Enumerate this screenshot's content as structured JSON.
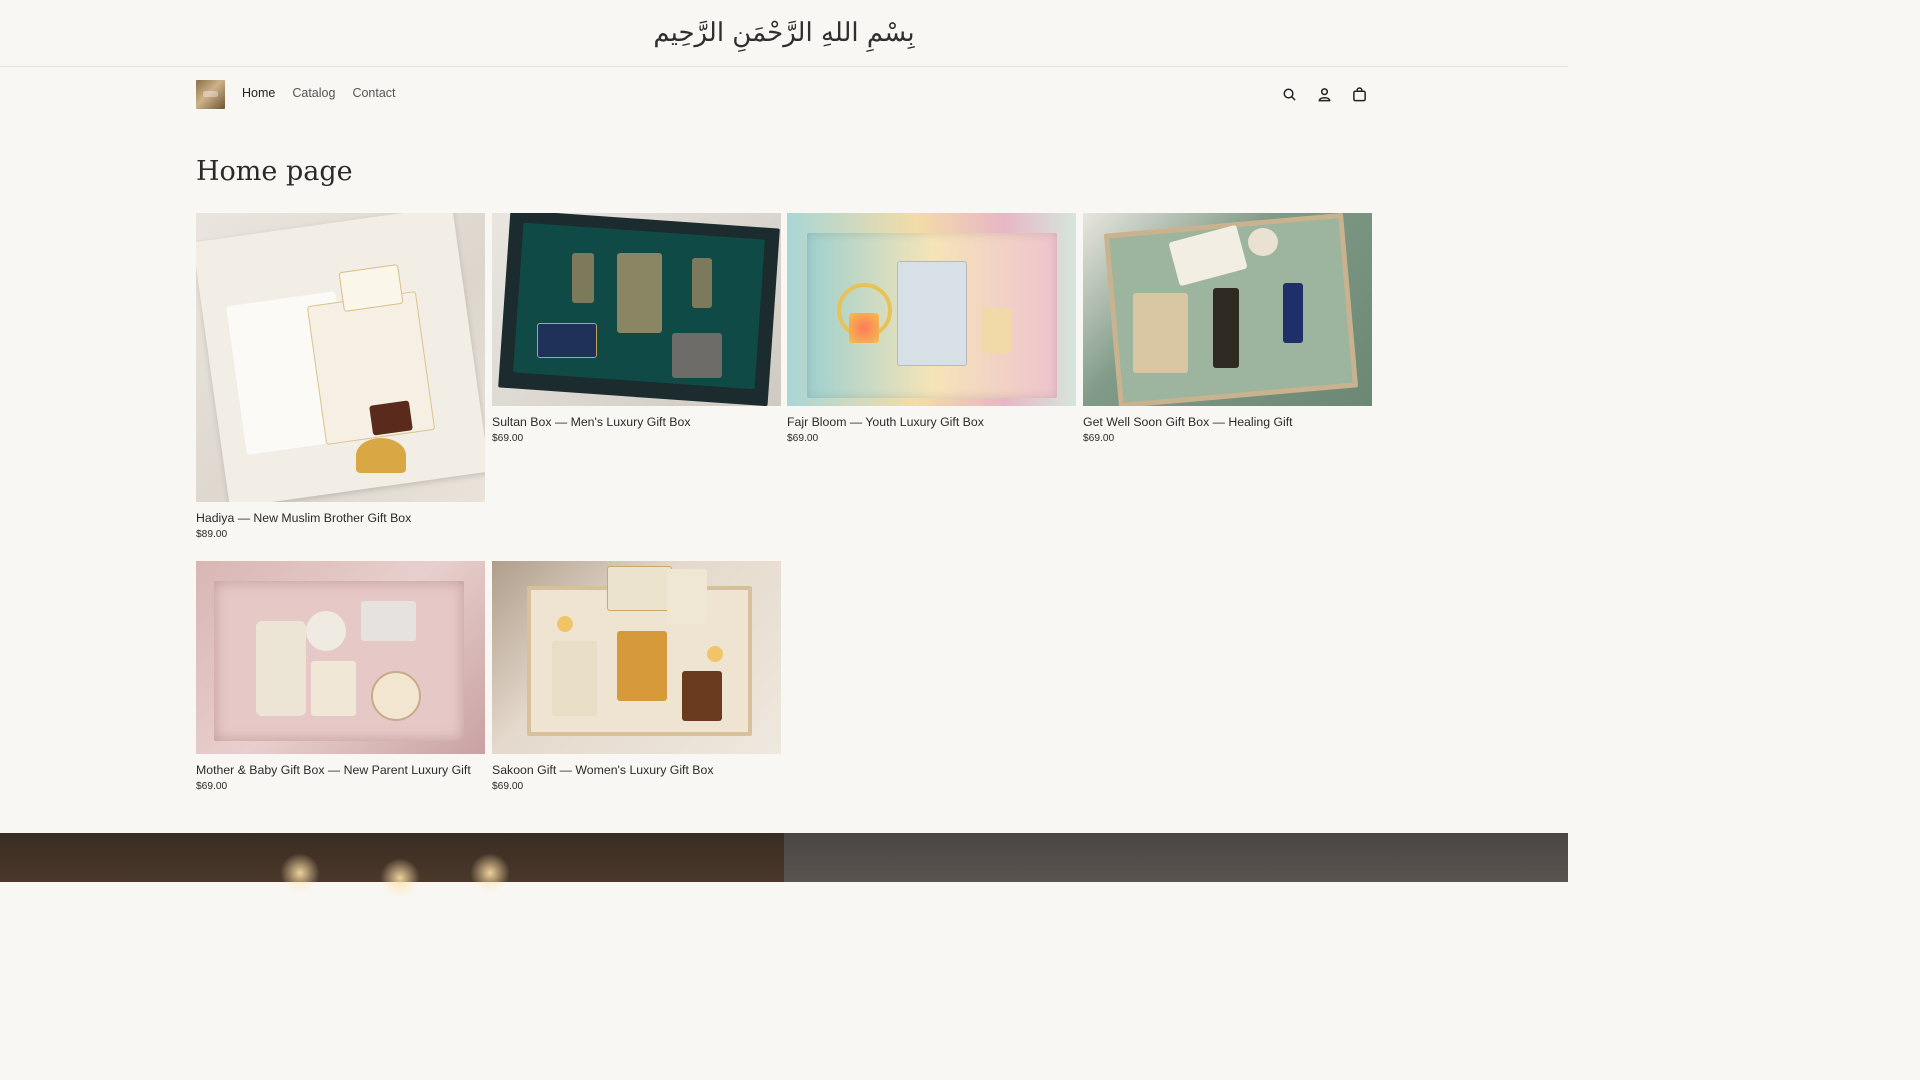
{
  "announcement": {
    "text": "بِسْمِ اللهِ الرَّحْمَنِ الرَّحِيم"
  },
  "nav": {
    "links": [
      {
        "label": "Home"
      },
      {
        "label": "Catalog"
      },
      {
        "label": "Contact"
      }
    ],
    "icons": [
      "search-icon",
      "account-icon",
      "cart-icon"
    ]
  },
  "page": {
    "title": "Home page"
  },
  "products": [
    {
      "name": "Hadiya — New Muslim Brother Gift Box",
      "price": "$89.00"
    },
    {
      "name": "Sultan Box — Men's Luxury Gift Box",
      "price": "$69.00"
    },
    {
      "name": "Fajr Bloom — Youth Luxury Gift Box",
      "price": "$69.00"
    },
    {
      "name": "Get Well Soon Gift Box — Healing Gift",
      "price": "$69.00"
    },
    {
      "name": "Mother & Baby Gift Box — New Parent Luxury Gift",
      "price": "$69.00"
    },
    {
      "name": "Sakoon Gift — Women's Luxury Gift Box",
      "price": "$69.00"
    }
  ],
  "colors": {
    "background": "#f9f7f3",
    "text": "#2b2b2b",
    "divider": "#e8e4dc"
  }
}
